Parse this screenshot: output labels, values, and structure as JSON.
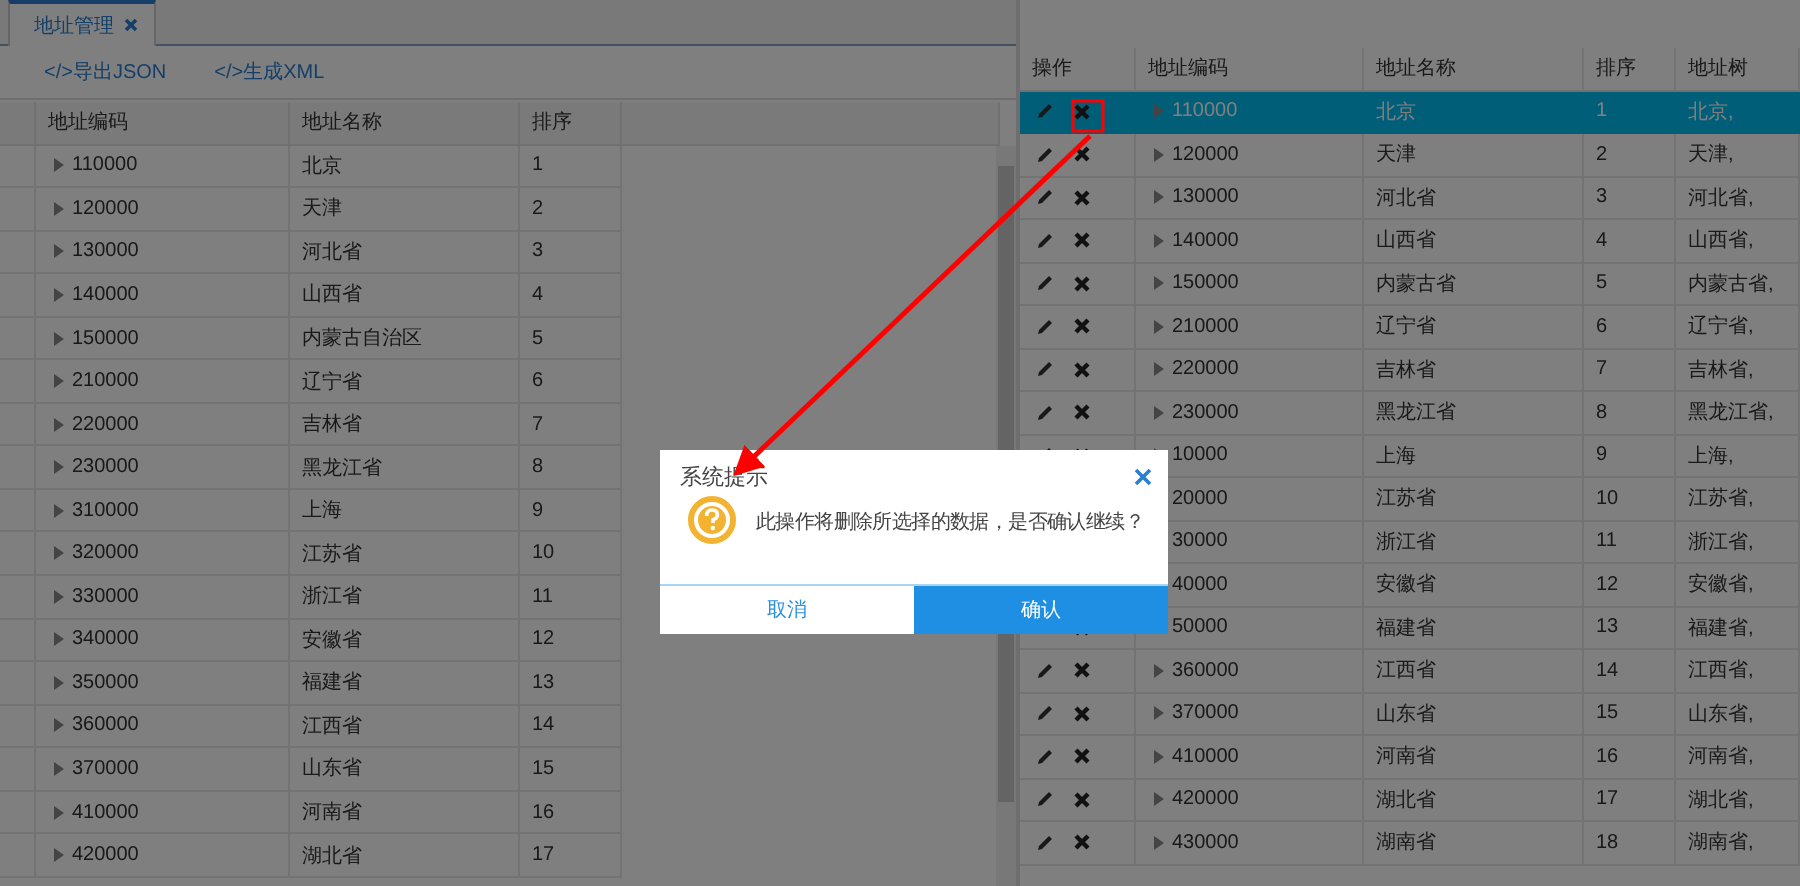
{
  "tabs": [
    {
      "label": "地址管理",
      "selected": true
    }
  ],
  "toolbar": [
    "</>导出JSON",
    "</>生成XML"
  ],
  "left_table": {
    "columns": [
      "地址编码",
      "地址名称",
      "排序"
    ],
    "rows": [
      {
        "code": "110000",
        "name": "北京",
        "order": "1"
      },
      {
        "code": "120000",
        "name": "天津",
        "order": "2"
      },
      {
        "code": "130000",
        "name": "河北省",
        "order": "3"
      },
      {
        "code": "140000",
        "name": "山西省",
        "order": "4"
      },
      {
        "code": "150000",
        "name": "内蒙古自治区",
        "order": "5"
      },
      {
        "code": "210000",
        "name": "辽宁省",
        "order": "6"
      },
      {
        "code": "220000",
        "name": "吉林省",
        "order": "7"
      },
      {
        "code": "230000",
        "name": "黑龙江省",
        "order": "8"
      },
      {
        "code": "310000",
        "name": "上海",
        "order": "9"
      },
      {
        "code": "320000",
        "name": "江苏省",
        "order": "10"
      },
      {
        "code": "330000",
        "name": "浙江省",
        "order": "11"
      },
      {
        "code": "340000",
        "name": "安徽省",
        "order": "12"
      },
      {
        "code": "350000",
        "name": "福建省",
        "order": "13"
      },
      {
        "code": "360000",
        "name": "江西省",
        "order": "14"
      },
      {
        "code": "370000",
        "name": "山东省",
        "order": "15"
      },
      {
        "code": "410000",
        "name": "河南省",
        "order": "16"
      },
      {
        "code": "420000",
        "name": "湖北省",
        "order": "17"
      }
    ]
  },
  "right_table": {
    "columns": [
      "操作",
      "地址编码",
      "地址名称",
      "排序",
      "地址树"
    ],
    "rows": [
      {
        "selected": true,
        "code": "110000",
        "name": "北京",
        "order": "1",
        "tree": "北京,"
      },
      {
        "selected": false,
        "code": "120000",
        "name": "天津",
        "order": "2",
        "tree": "天津,"
      },
      {
        "selected": false,
        "code": "130000",
        "name": "河北省",
        "order": "3",
        "tree": "河北省,"
      },
      {
        "selected": false,
        "code": "140000",
        "name": "山西省",
        "order": "4",
        "tree": "山西省,"
      },
      {
        "selected": false,
        "code": "150000",
        "name": "内蒙古省",
        "order": "5",
        "tree": "内蒙古省,"
      },
      {
        "selected": false,
        "code": "210000",
        "name": "辽宁省",
        "order": "6",
        "tree": "辽宁省,"
      },
      {
        "selected": false,
        "code": "220000",
        "name": "吉林省",
        "order": "7",
        "tree": "吉林省,"
      },
      {
        "selected": false,
        "code": "230000",
        "name": "黑龙江省",
        "order": "8",
        "tree": "黑龙江省,"
      },
      {
        "selected": false,
        "code": "10000",
        "name": "上海",
        "order": "9",
        "tree": "上海,"
      },
      {
        "selected": false,
        "code": "20000",
        "name": "江苏省",
        "order": "10",
        "tree": "江苏省,",
        "actions_covered": true
      },
      {
        "selected": false,
        "code": "30000",
        "name": "浙江省",
        "order": "11",
        "tree": "浙江省,",
        "actions_covered": true
      },
      {
        "selected": false,
        "code": "40000",
        "name": "安徽省",
        "order": "12",
        "tree": "安徽省,"
      },
      {
        "selected": false,
        "code": "50000",
        "name": "福建省",
        "order": "13",
        "tree": "福建省,"
      },
      {
        "selected": false,
        "code": "360000",
        "name": "江西省",
        "order": "14",
        "tree": "江西省,"
      },
      {
        "selected": false,
        "code": "370000",
        "name": "山东省",
        "order": "15",
        "tree": "山东省,"
      },
      {
        "selected": false,
        "code": "410000",
        "name": "河南省",
        "order": "16",
        "tree": "河南省,"
      },
      {
        "selected": false,
        "code": "420000",
        "name": "湖北省",
        "order": "17",
        "tree": "湖北省,"
      },
      {
        "selected": false,
        "code": "430000",
        "name": "湖南省",
        "order": "18",
        "tree": "湖南省,"
      }
    ]
  },
  "dialog": {
    "title": "系统提示",
    "message": "此操作将删除所选择的数据，是否确认继续？",
    "buttons": [
      {
        "label": "取消",
        "kind": "secondary"
      },
      {
        "label": "确认",
        "kind": "primary"
      }
    ]
  }
}
